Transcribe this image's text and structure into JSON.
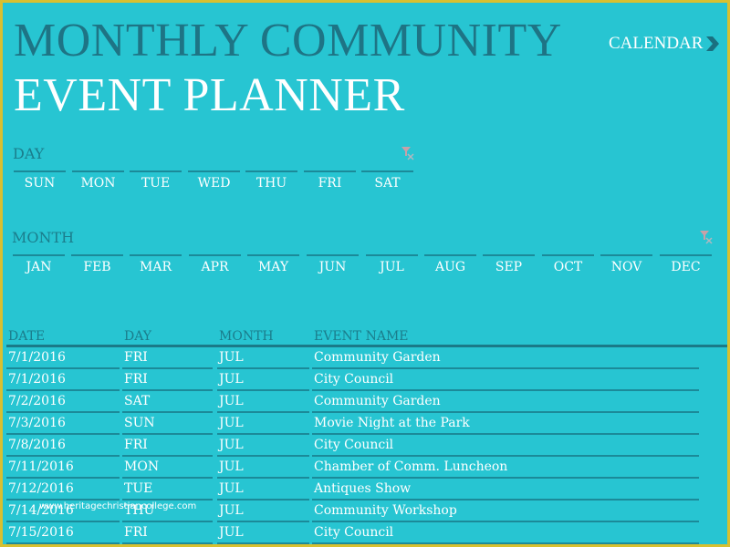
{
  "header": {
    "title_line1": "MONTHLY COMMUNITY",
    "title_line2": "EVENT PLANNER",
    "calendar_link": "CALENDAR",
    "calendar_icon": "chevron-right-icon"
  },
  "day_slicer": {
    "label": "DAY",
    "clear_filter_icon": "clear-filter-icon",
    "items": [
      "SUN",
      "MON",
      "TUE",
      "WED",
      "THU",
      "FRI",
      "SAT"
    ]
  },
  "month_slicer": {
    "label": "MONTH",
    "clear_filter_icon": "clear-filter-icon",
    "items": [
      "JAN",
      "FEB",
      "MAR",
      "APR",
      "MAY",
      "JUN",
      "JUL",
      "AUG",
      "SEP",
      "OCT",
      "NOV",
      "DEC"
    ]
  },
  "table": {
    "columns": [
      "DATE",
      "DAY",
      "MONTH",
      "EVENT NAME"
    ],
    "rows": [
      [
        "7/1/2016",
        "FRI",
        "JUL",
        "Community Garden"
      ],
      [
        "7/1/2016",
        "FRI",
        "JUL",
        "City Council"
      ],
      [
        "7/2/2016",
        "SAT",
        "JUL",
        "Community Garden"
      ],
      [
        "7/3/2016",
        "SUN",
        "JUL",
        "Movie Night at the Park"
      ],
      [
        "7/8/2016",
        "FRI",
        "JUL",
        "City Council"
      ],
      [
        "7/11/2016",
        "MON",
        "JUL",
        "Chamber of Comm. Luncheon"
      ],
      [
        "7/12/2016",
        "TUE",
        "JUL",
        "Antiques Show"
      ],
      [
        "7/14/2016",
        "THU",
        "JUL",
        "Community Workshop"
      ],
      [
        "7/15/2016",
        "FRI",
        "JUL",
        "City Council"
      ]
    ]
  },
  "watermark": "www.heritagechristiancollege.com",
  "colors": {
    "background": "#27c5d2",
    "frame": "#d8c030",
    "title_dark": "#1e7485",
    "text_light": "#ffffff",
    "rule": "#1b8a99"
  }
}
